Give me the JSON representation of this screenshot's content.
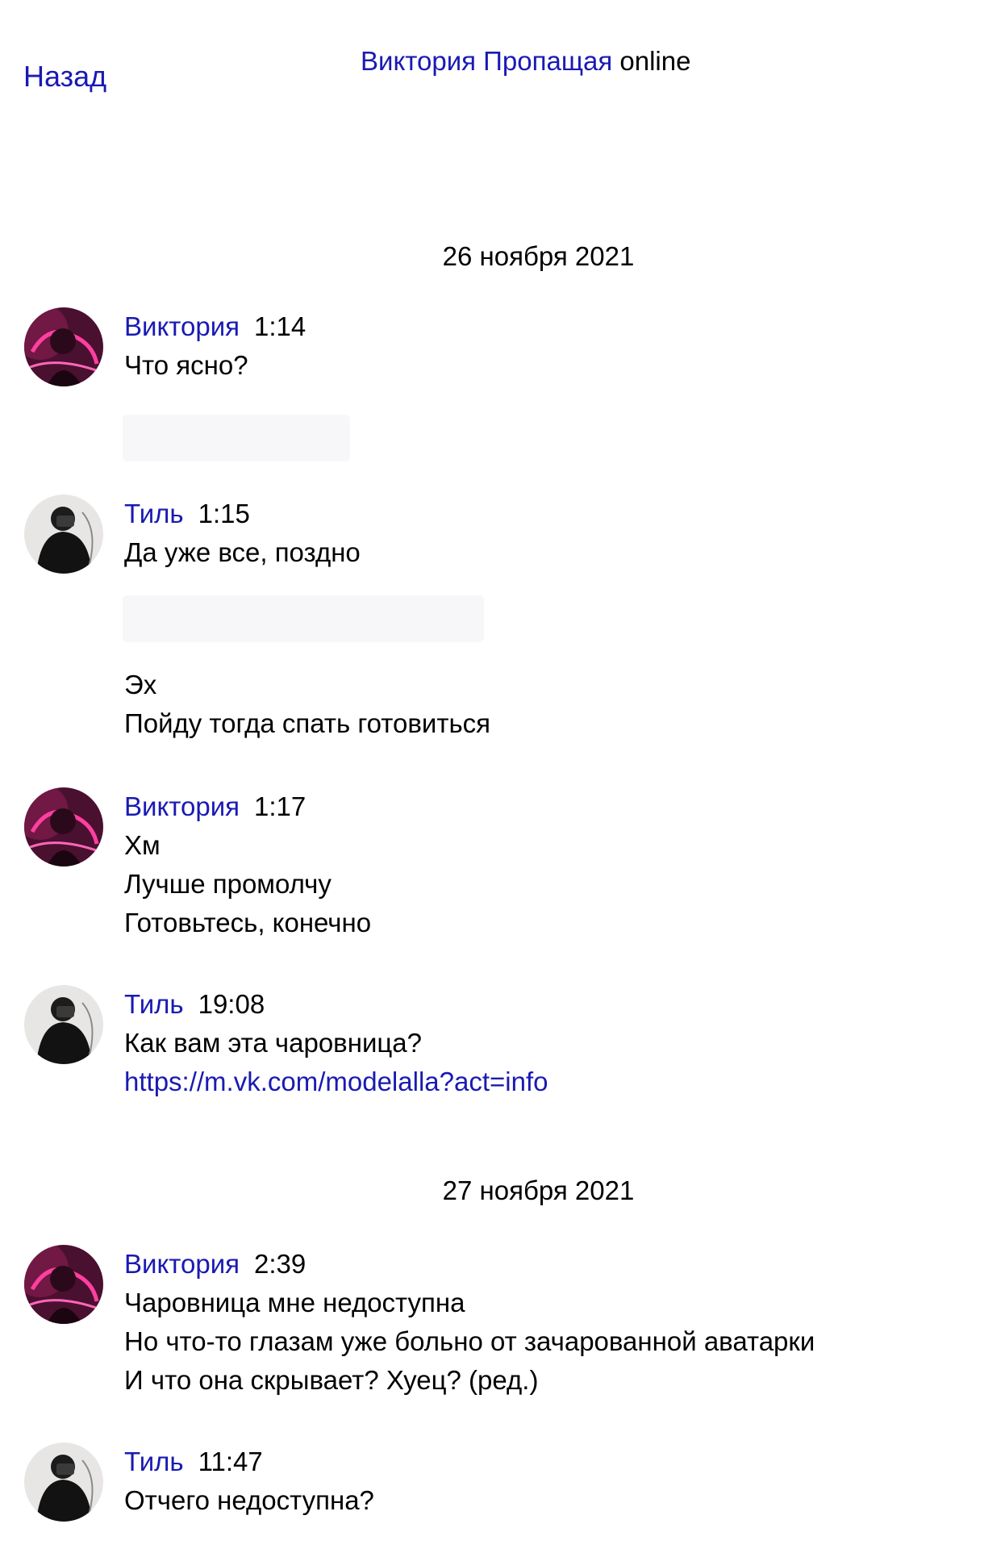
{
  "header": {
    "back_label": "Назад",
    "contact_name": "Виктория Пропащая",
    "status": "online"
  },
  "dates": [
    "26 ноября 2021",
    "27 ноября 2021"
  ],
  "messages": [
    {
      "author": "Виктория",
      "time": "1:14",
      "avatar": "viktoria-avatar",
      "lines": [
        "Что ясно?"
      ]
    },
    {
      "author": "Тиль",
      "time": "1:15",
      "avatar": "til-avatar",
      "lines": [
        "Да уже все, поздно",
        "Эх",
        "Пойду тогда спать готовиться"
      ]
    },
    {
      "author": "Виктория",
      "time": "1:17",
      "avatar": "viktoria-avatar",
      "lines": [
        "Хм",
        "Лучше промолчу",
        "Готовьтесь, конечно"
      ]
    },
    {
      "author": "Тиль",
      "time": "19:08",
      "avatar": "til-avatar",
      "lines": [
        "Как вам эта чаровница?",
        "https://m.vk.com/modelalla?act=info"
      ]
    },
    {
      "author": "Виктория",
      "time": "2:39",
      "avatar": "viktoria-avatar",
      "lines": [
        "Чаровница мне недоступна",
        "Но что-то глазам уже больно от зачарованной аватарки",
        "И что она скрывает? Хуец? (ред.)"
      ]
    },
    {
      "author": "Тиль",
      "time": "11:47",
      "avatar": "til-avatar",
      "lines": [
        "Отчего недоступна?"
      ]
    }
  ],
  "colors": {
    "link": "#1a1ab3",
    "text": "#000000",
    "background": "#ffffff"
  }
}
